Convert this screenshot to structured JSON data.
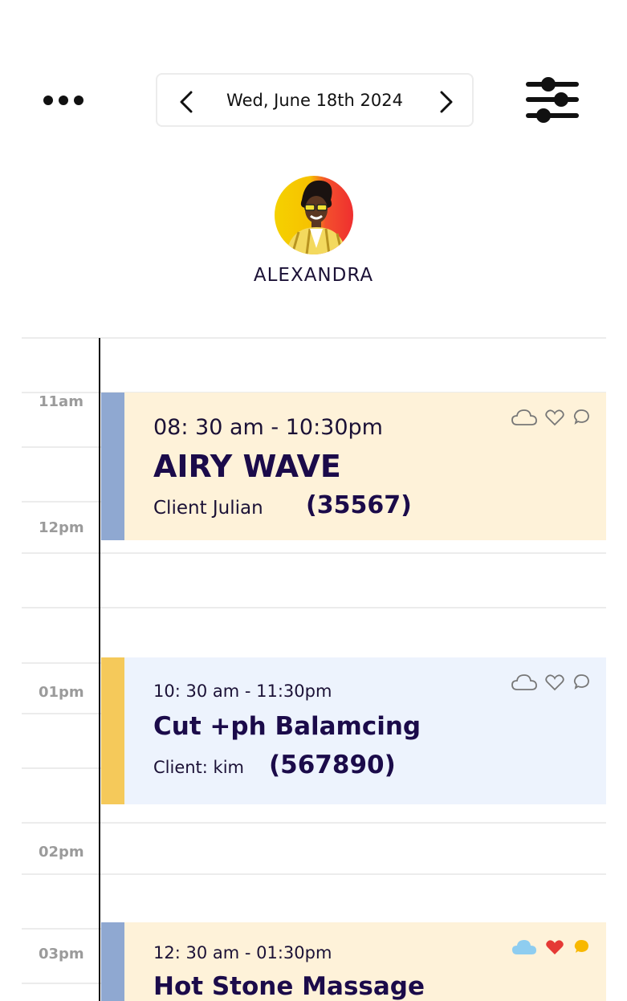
{
  "header": {
    "date_label": "Wed, June 18th 2024",
    "more_icon": "more-horizontal-icon",
    "filter_icon": "sliders-icon"
  },
  "staff": {
    "name": "ALEXANDRA"
  },
  "time_labels": [
    "11am",
    "12pm",
    "01pm",
    "02pm",
    "03pm"
  ],
  "appointments": [
    {
      "time": "08: 30 am - 10:30pm",
      "service": "AIRY WAVE",
      "client": "Client Julian",
      "code": "(35567)",
      "stripe_color": "#8fa8d1",
      "bg_color": "#fef2d9"
    },
    {
      "time": "10: 30 am - 11:30pm",
      "service": "Cut +ph Balamcing",
      "client": "Client: kim",
      "code": "(567890)",
      "stripe_color": "#f5c95a",
      "bg_color": "#edf3fd"
    },
    {
      "time": "12: 30 am - 01:30pm",
      "service": "Hot Stone Massage",
      "stripe_color": "#8fa8d1",
      "bg_color": "#fef2d9",
      "status_icons": {
        "cloud": "#8ecdf0",
        "heart": "#e53935",
        "chat": "#f8b800"
      }
    }
  ]
}
